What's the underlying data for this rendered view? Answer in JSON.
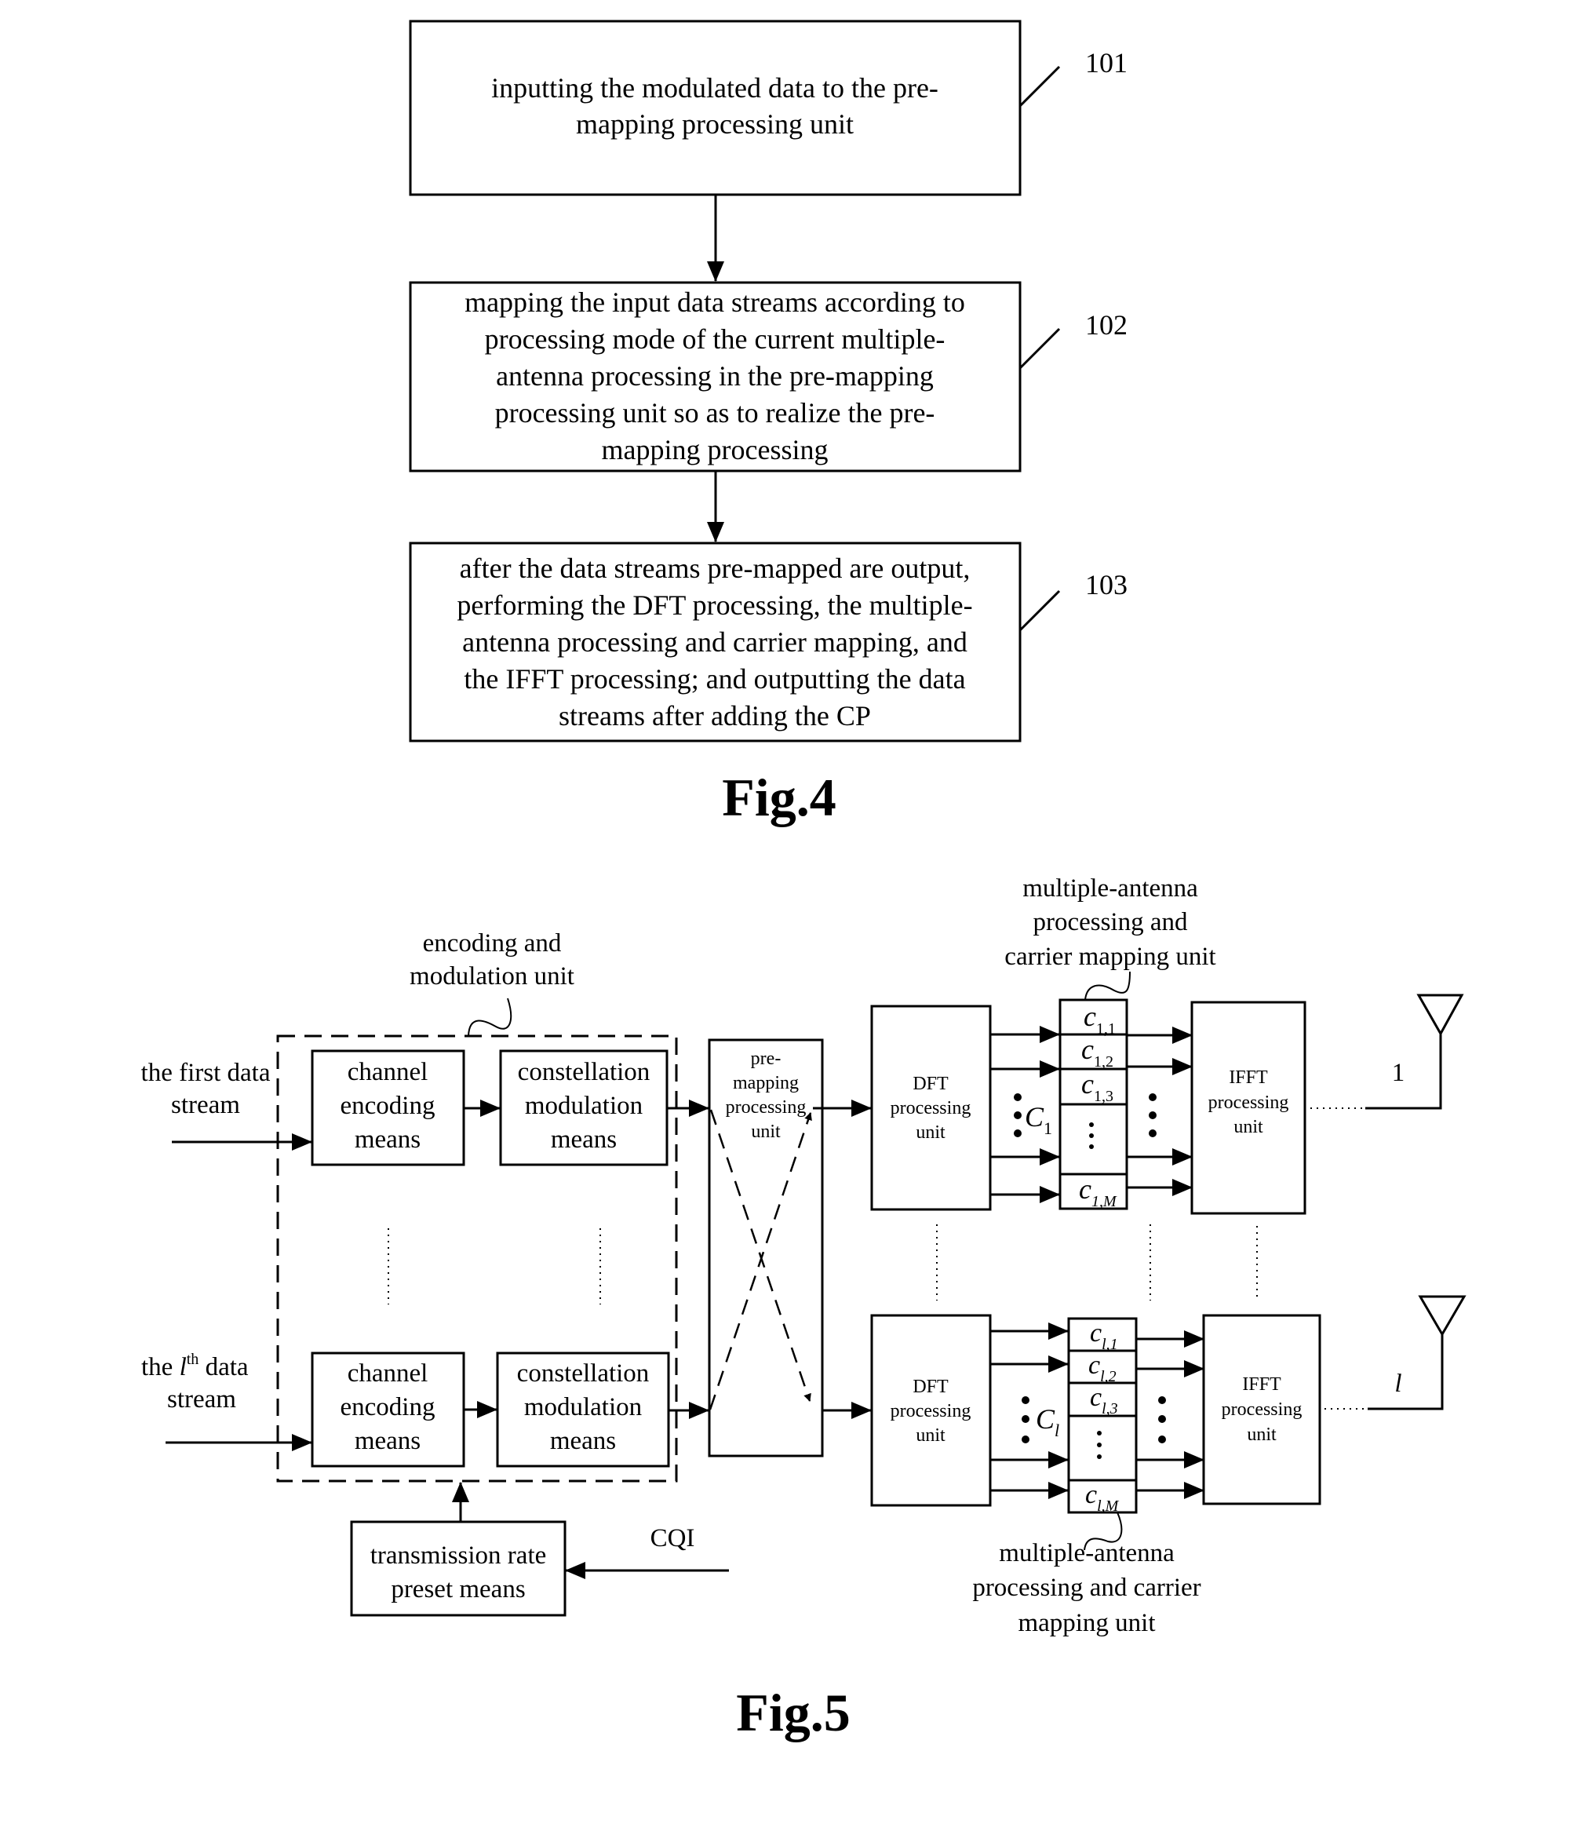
{
  "fig4": {
    "caption": "Fig.4",
    "steps": [
      {
        "ref": "101",
        "lines": [
          "inputting the modulated data to the pre-",
          "mapping processing unit"
        ]
      },
      {
        "ref": "102",
        "lines": [
          "mapping the input data streams according to",
          "processing mode of the current multiple-",
          "antenna processing in the pre-mapping",
          "processing unit so as to realize the pre-",
          "mapping processing"
        ]
      },
      {
        "ref": "103",
        "lines": [
          "after the data streams pre-mapped are output,",
          "performing the DFT processing, the multiple-",
          "antenna processing and carrier mapping, and",
          "the IFFT processing; and outputting the data",
          "streams after adding the CP"
        ]
      }
    ]
  },
  "fig5": {
    "caption": "Fig.5",
    "encoding_unit_label": [
      "encoding and",
      "modulation unit"
    ],
    "stream1_label": [
      "the first data",
      "stream"
    ],
    "streamL_label": {
      "prefix": "the ",
      "var": "l",
      "sup": "th",
      "suffix": " data",
      "line2": "stream"
    },
    "channel_encoding": [
      "channel",
      "encoding",
      "means"
    ],
    "constellation": [
      "constellation",
      "modulation",
      "means"
    ],
    "premapping": [
      "pre-",
      "mapping",
      "processing",
      "unit"
    ],
    "dft": [
      "DFT",
      "processing",
      "unit"
    ],
    "ifft": [
      "IFFT",
      "processing",
      "unit"
    ],
    "transmission": [
      "transmission rate",
      "preset means"
    ],
    "cqi": "CQI",
    "top_mapping_label": [
      "multiple-antenna",
      "processing and",
      "carrier mapping unit"
    ],
    "bottom_mapping_label": [
      "multiple-antenna",
      "processing and carrier",
      "mapping unit"
    ],
    "group1": {
      "C": "C",
      "Csub": "1",
      "cells": [
        {
          "c": "c",
          "sub": "1,1"
        },
        {
          "c": "c",
          "sub": "1,2"
        },
        {
          "c": "c",
          "sub": "1,3"
        },
        {
          "c": "c",
          "sub": "1,M"
        }
      ],
      "antenna": "1"
    },
    "groupL": {
      "C": "C",
      "Csub": "l",
      "cells": [
        {
          "c": "c",
          "sub": "l,1"
        },
        {
          "c": "c",
          "sub": "l,2"
        },
        {
          "c": "c",
          "sub": "l,3"
        },
        {
          "c": "c",
          "sub": "l,M"
        }
      ],
      "antenna": "l"
    }
  }
}
